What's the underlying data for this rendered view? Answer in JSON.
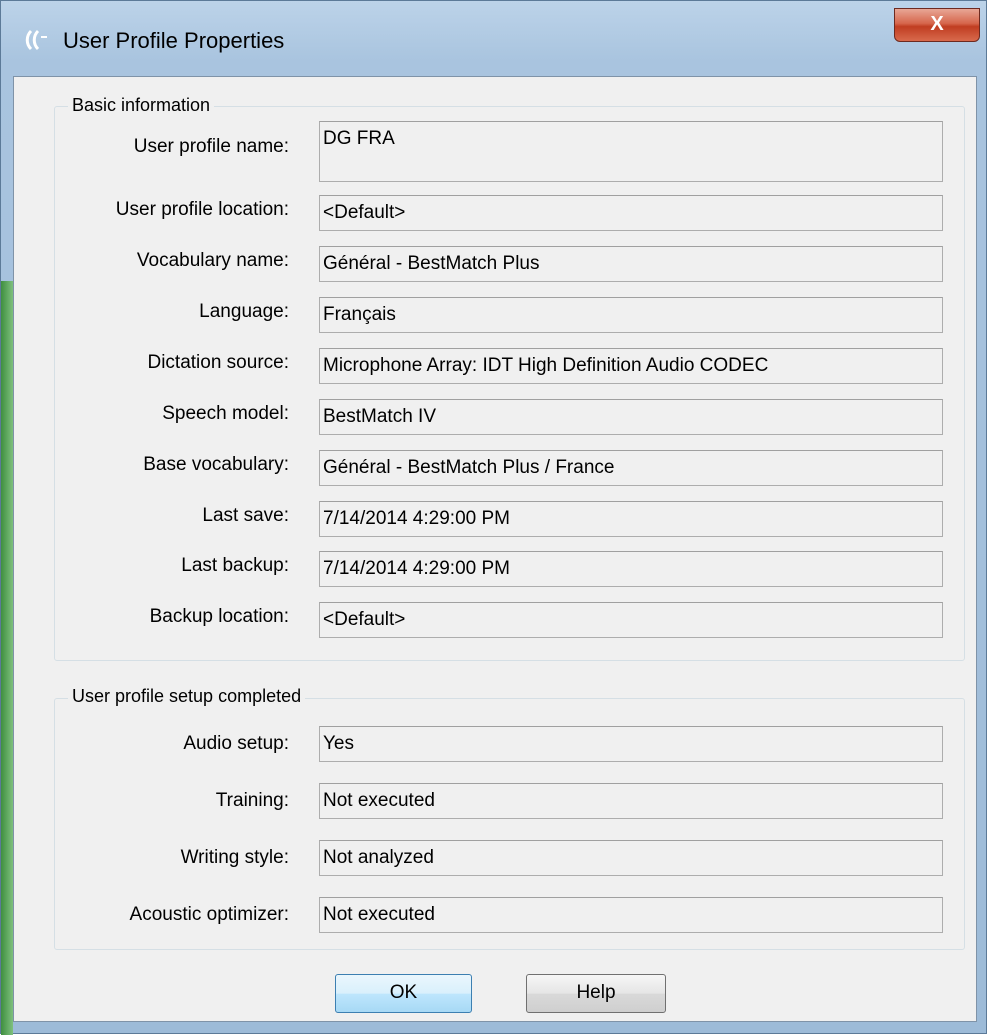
{
  "window": {
    "title": "User Profile Properties",
    "close_label": "X"
  },
  "basic": {
    "legend": "Basic information",
    "fields": [
      {
        "label": "User profile name:",
        "value": "DG FRA"
      },
      {
        "label": "User profile location:",
        "value": "<Default>"
      },
      {
        "label": "Vocabulary name:",
        "value": "Général - BestMatch Plus"
      },
      {
        "label": "Language:",
        "value": "Français"
      },
      {
        "label": "Dictation source:",
        "value": "Microphone Array: IDT High Definition Audio CODEC"
      },
      {
        "label": "Speech model:",
        "value": "BestMatch IV"
      },
      {
        "label": "Base vocabulary:",
        "value": "Général - BestMatch Plus / France"
      },
      {
        "label": "Last save:",
        "value": "7/14/2014 4:29:00 PM"
      },
      {
        "label": "Last backup:",
        "value": "7/14/2014 4:29:00 PM"
      },
      {
        "label": "Backup location:",
        "value": "<Default>"
      }
    ]
  },
  "setup": {
    "legend": "User profile setup completed",
    "fields": [
      {
        "label": "Audio setup:",
        "value": "Yes"
      },
      {
        "label": "Training:",
        "value": "Not executed"
      },
      {
        "label": "Writing style:",
        "value": "Not analyzed"
      },
      {
        "label": "Acoustic optimizer:",
        "value": "Not executed"
      }
    ]
  },
  "buttons": {
    "ok": "OK",
    "help": "Help"
  }
}
